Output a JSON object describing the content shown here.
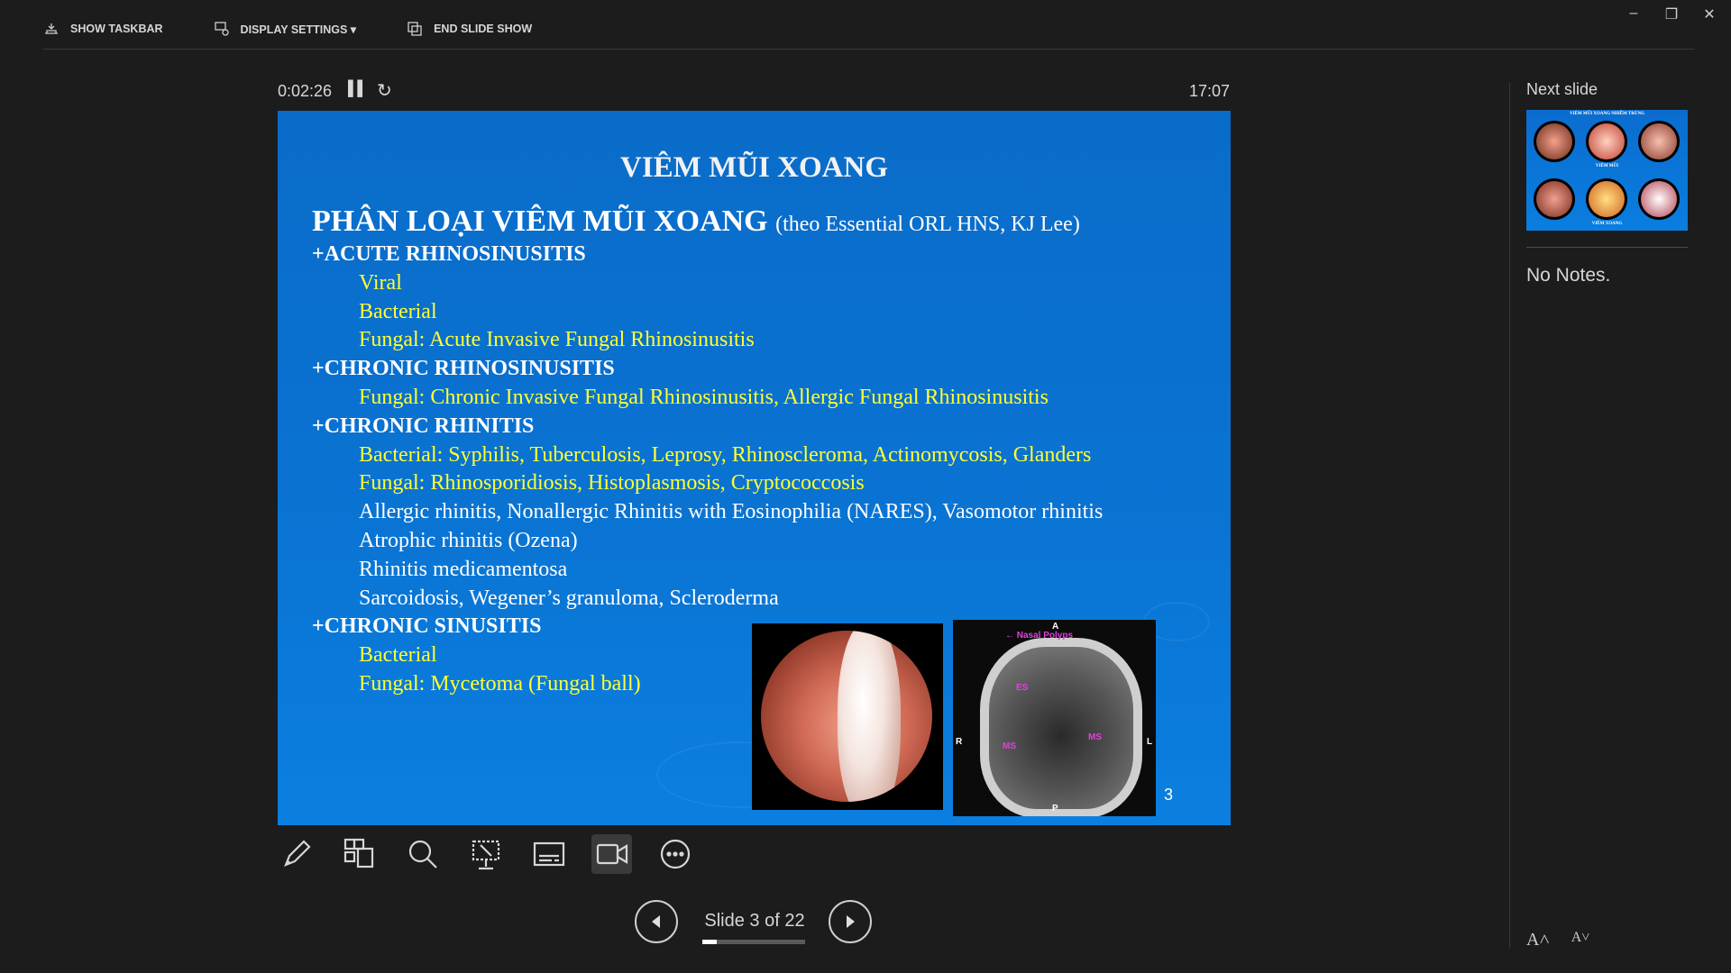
{
  "toolbar": {
    "show_taskbar": "SHOW TASKBAR",
    "display_settings": "DISPLAY SETTINGS ▾",
    "end_slide_show": "END SLIDE SHOW"
  },
  "timer": {
    "elapsed": "0:02:26",
    "clock": "17:07"
  },
  "slide": {
    "title": "VIÊM MŨI XOANG",
    "heading": "PHÂN LOẠI VIÊM MŨI XOANG",
    "heading_sub": "(theo Essential ORL HNS, KJ Lee)",
    "lines": [
      {
        "text": "+ACUTE RHINOSINUSITIS",
        "style": "cat"
      },
      {
        "text": "Viral",
        "style": "y"
      },
      {
        "text": "Bacterial",
        "style": "y"
      },
      {
        "text": "Fungal: Acute Invasive Fungal Rhinosinusitis",
        "style": "y"
      },
      {
        "text": "+CHRONIC RHINOSINUSITIS",
        "style": "cat"
      },
      {
        "text": "Fungal: Chronic Invasive Fungal Rhinosinusitis, Allergic Fungal Rhinosinusitis",
        "style": "y"
      },
      {
        "text": "+CHRONIC RHINITIS",
        "style": "cat"
      },
      {
        "text": "Bacterial: Syphilis, Tuberculosis, Leprosy, Rhinoscleroma, Actinomycosis, Glanders",
        "style": "y"
      },
      {
        "text": "Fungal: Rhinosporidiosis, Histoplasmosis, Cryptococcosis",
        "style": "y"
      },
      {
        "text": "Allergic rhinitis, Nonallergic Rhinitis with Eosinophilia (NARES), Vasomotor rhinitis",
        "style": "w"
      },
      {
        "text": "Atrophic rhinitis (Ozena)",
        "style": "w"
      },
      {
        "text": "Rhinitis medicamentosa",
        "style": "w"
      },
      {
        "text": "Sarcoidosis, Wegener’s granuloma, Scleroderma",
        "style": "w"
      },
      {
        "text": "+CHRONIC SINUSITIS",
        "style": "cat"
      },
      {
        "text": "Bacterial",
        "style": "y"
      },
      {
        "text": "Fungal: Mycetoma (Fungal ball)",
        "style": "y"
      }
    ],
    "ct_labels": {
      "polyps": "← Nasal Polyps",
      "es": "ES",
      "ms_left": "MS",
      "ms_right": "MS",
      "r": "R",
      "l": "L",
      "a": "A",
      "p": "P"
    },
    "number": "3"
  },
  "navigation": {
    "slide_counter": "Slide 3 of 22",
    "current": 3,
    "total": 22
  },
  "right_panel": {
    "next_slide_label": "Next slide",
    "next_slide_title": "VIÊM MŨI XOANG NHIỄM TRÙNG",
    "next_slide_mid": "VIÊM MŨI",
    "next_slide_bottom": "VIÊM XOANG",
    "notes": "No Notes."
  },
  "colors": {
    "slide_yellow": "#ffff33",
    "slide_blue": "#0a72d1",
    "background": "#1c1c1c"
  },
  "icons": {
    "tools": [
      "pen-icon",
      "slides-grid-icon",
      "zoom-icon",
      "laser-pointer-icon",
      "subtitles-icon",
      "camera-icon",
      "more-icon"
    ]
  }
}
